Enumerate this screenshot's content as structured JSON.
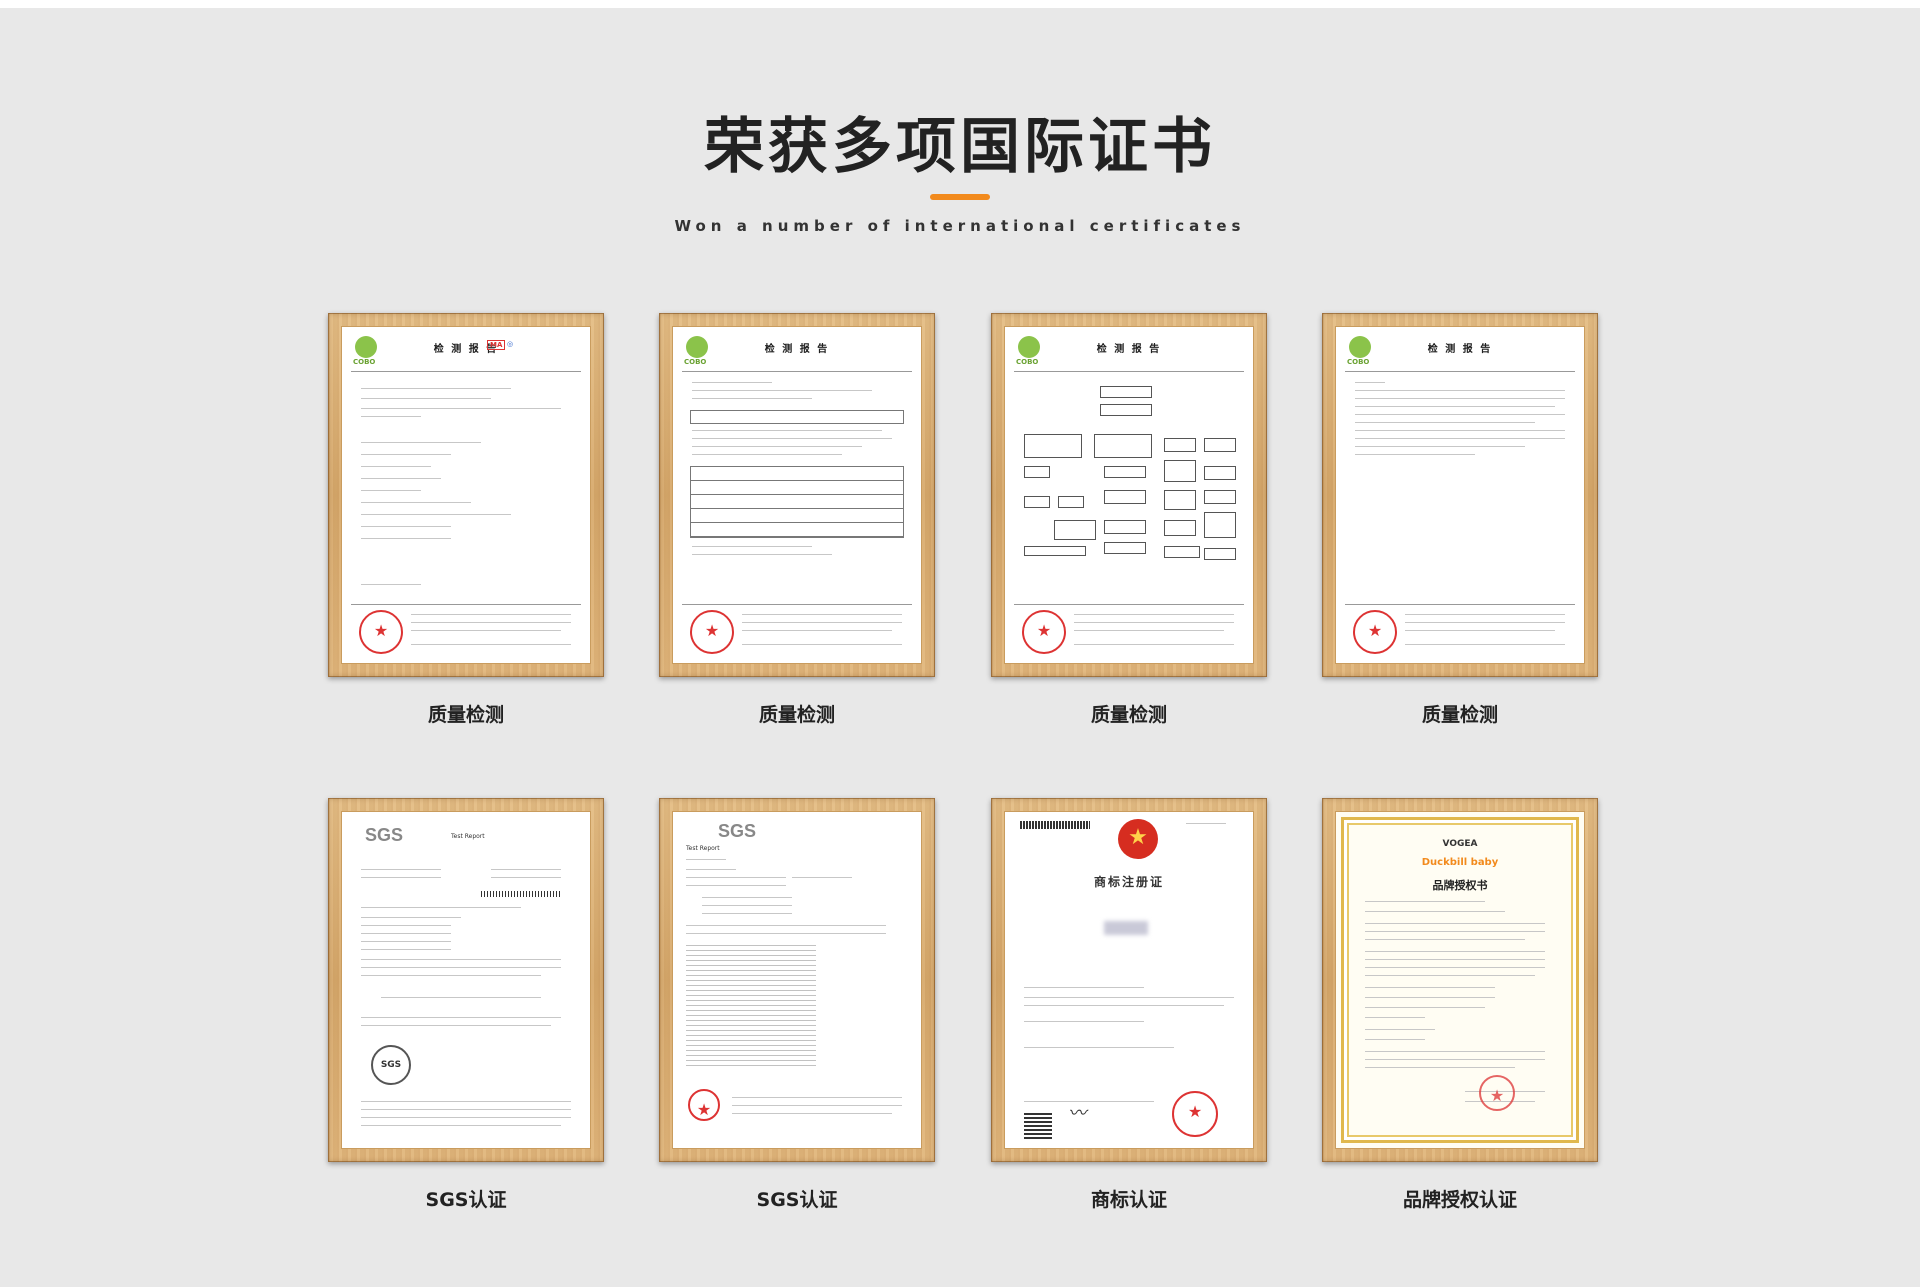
{
  "header": {
    "title": "荣获多项国际证书",
    "subtitle": "Won a number of international certificates"
  },
  "colors": {
    "background": "#e8e8e8",
    "accent": "#f28a1c",
    "frame_wood": "#d9ab6c"
  },
  "certificates": [
    {
      "caption": "质量检测",
      "doc_title": "检 测 报 告",
      "logo_text": "COBO",
      "type": "report-page-1"
    },
    {
      "caption": "质量检测",
      "doc_title": "检 测 报 告",
      "logo_text": "COBO",
      "type": "report-page-2"
    },
    {
      "caption": "质量检测",
      "doc_title": "检 测 报 告",
      "logo_text": "COBO",
      "type": "report-flowchart"
    },
    {
      "caption": "质量检测",
      "doc_title": "检 测 报 告",
      "logo_text": "COBO",
      "type": "report-notes"
    },
    {
      "caption": "SGS认证",
      "doc_title": "Test Report",
      "logo_text": "SGS",
      "type": "sgs-report"
    },
    {
      "caption": "SGS认证",
      "doc_title": "Test Report",
      "logo_text": "SGS",
      "type": "sgs-test-results"
    },
    {
      "caption": "商标认证",
      "doc_title": "商标注册证",
      "type": "trademark"
    },
    {
      "caption": "品牌授权认证",
      "doc_title": "品牌授权书",
      "brand_top": "VOGEA",
      "brand_main": "Duckbill baby",
      "type": "brand-authorization"
    }
  ]
}
